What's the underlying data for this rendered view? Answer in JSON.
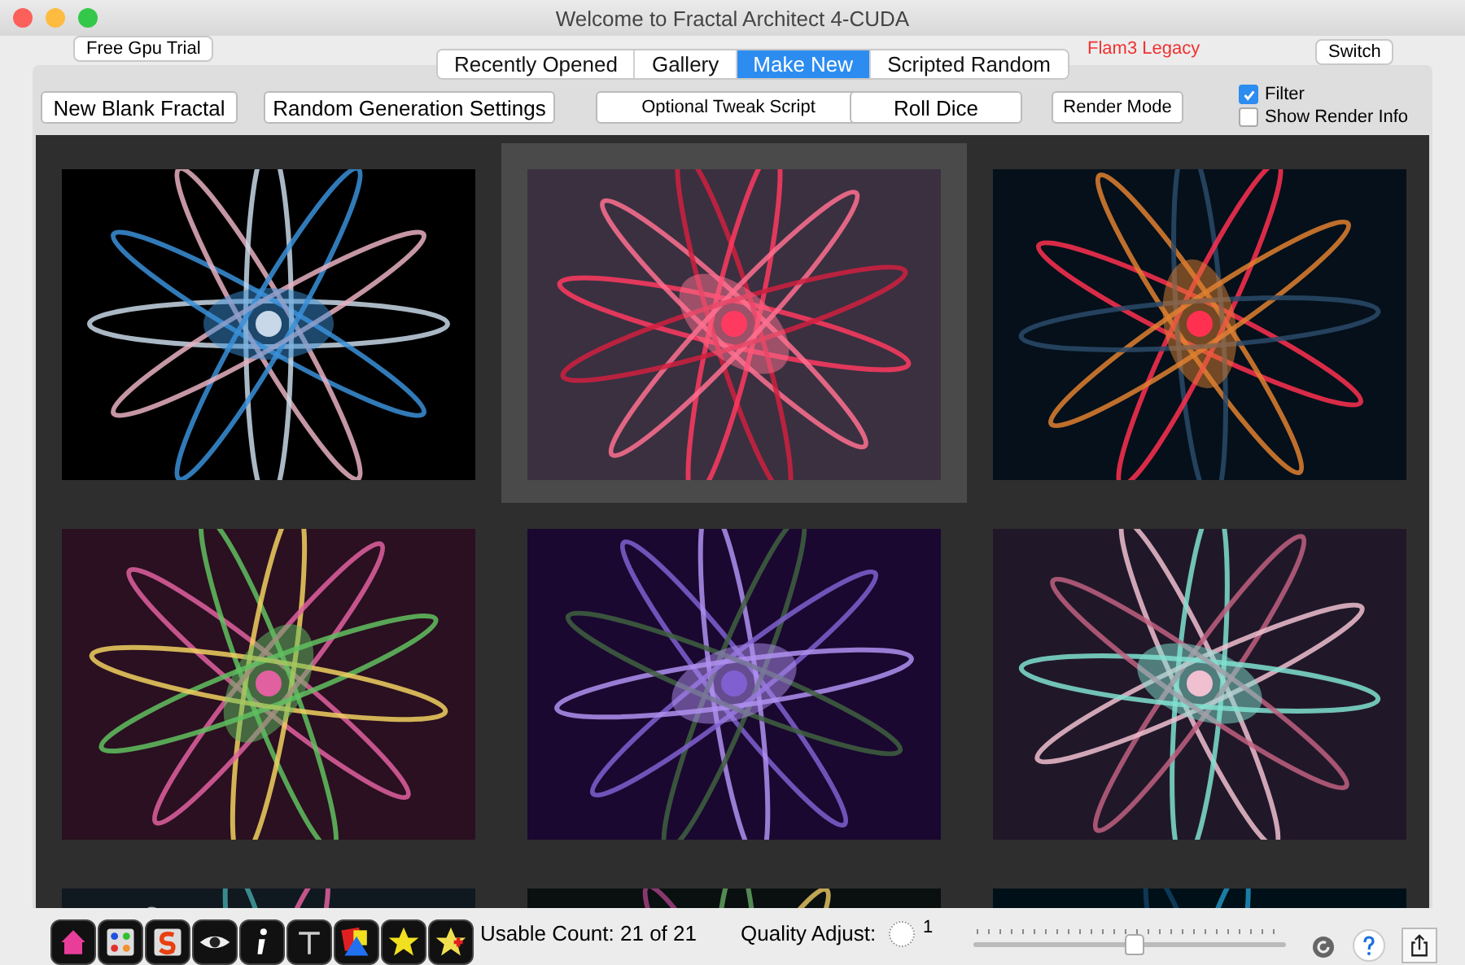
{
  "window": {
    "title": "Welcome to Fractal Architect 4-CUDA"
  },
  "trial_button": "Free Gpu Trial",
  "tabs": [
    {
      "label": "Recently Opened",
      "selected": false
    },
    {
      "label": "Gallery",
      "selected": false
    },
    {
      "label": "Make New",
      "selected": true
    },
    {
      "label": "Scripted Random",
      "selected": false
    }
  ],
  "legacy_label": "Flam3 Legacy",
  "switch_button": "Switch",
  "toolbar_buttons": [
    "New Blank Fractal",
    "Random Generation Settings",
    "Optional Tweak Script",
    "Roll Dice",
    "Render Mode"
  ],
  "options": [
    {
      "label": "Filter",
      "checked": true
    },
    {
      "label": "Show Render Info",
      "checked": false
    }
  ],
  "gallery": [
    {
      "kind": "picture",
      "selected": false
    },
    {
      "kind": "picture",
      "selected": true
    },
    {
      "kind": "picture",
      "selected": false
    },
    {
      "kind": "picture",
      "selected": false
    },
    {
      "kind": "picture",
      "selected": false
    },
    {
      "kind": "picture",
      "selected": false
    },
    {
      "kind": "picture",
      "selected": false
    },
    {
      "kind": "picture",
      "selected": false
    },
    {
      "kind": "picture",
      "selected": false
    }
  ],
  "usable_count": "Usable Count: 21 of 21",
  "quality": {
    "label": "Quality Adjust:",
    "value": "1"
  },
  "slider": {
    "level": 0.51
  }
}
